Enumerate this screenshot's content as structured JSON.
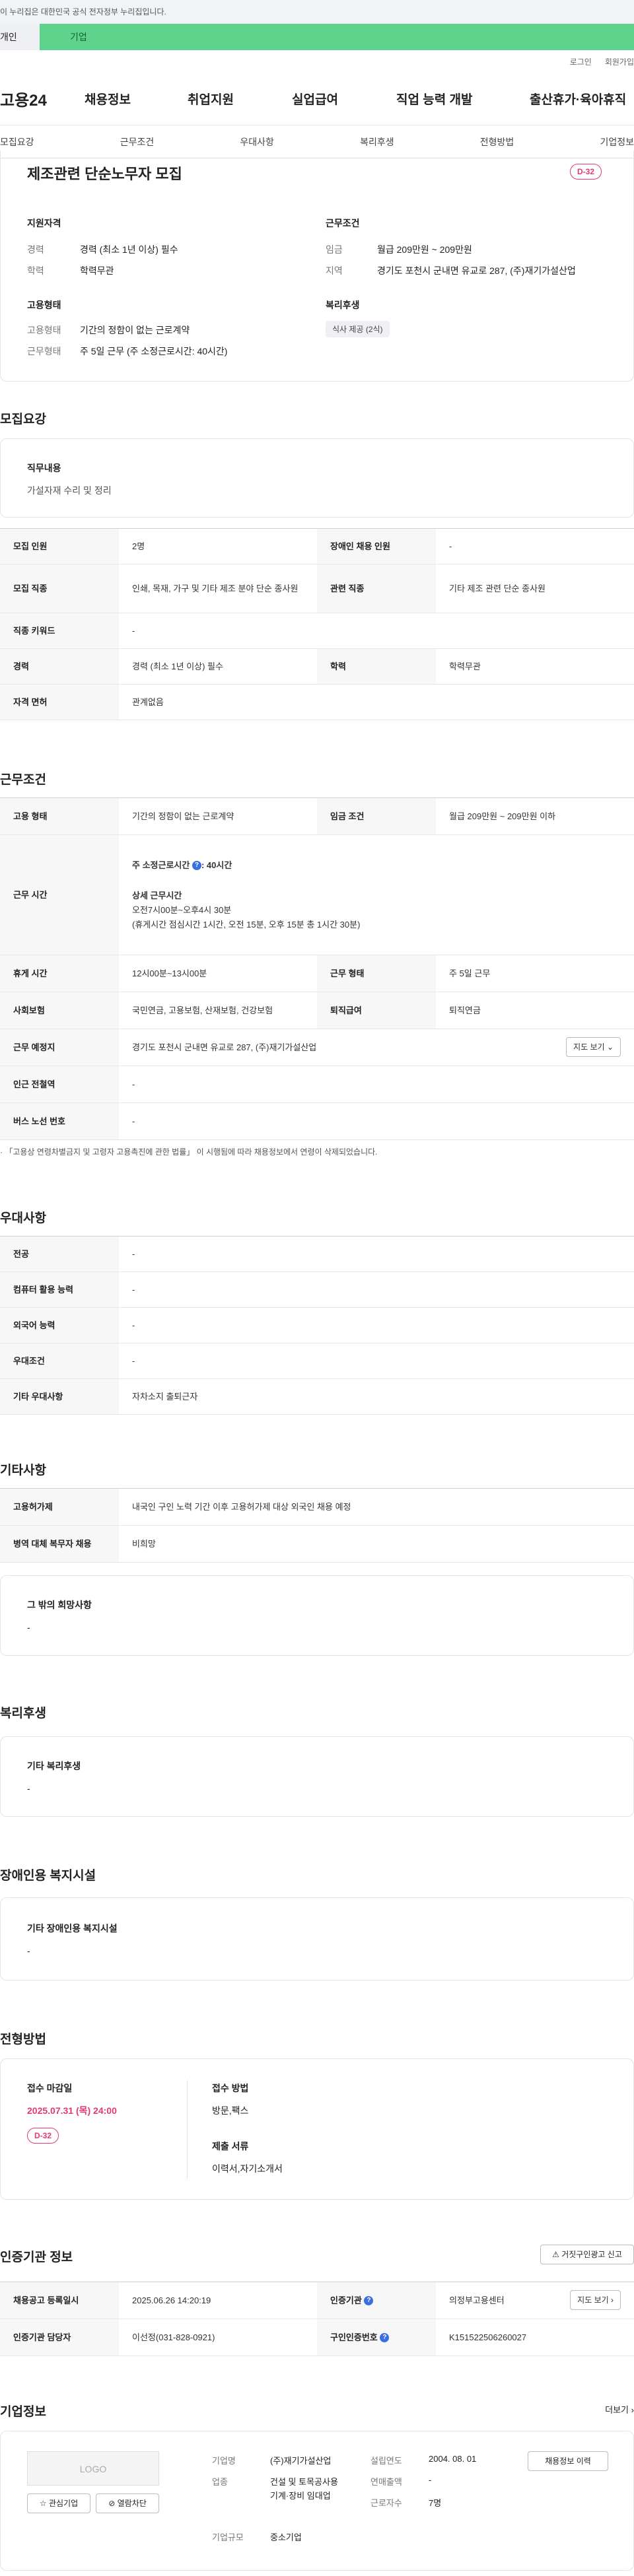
{
  "gov_banner": "이 누리집은 대한민국 공식 전자정부 누리집입니다.",
  "gnb": {
    "personal": "개인",
    "company": "기업"
  },
  "util": {
    "login": "로그인",
    "signup": "회원가입"
  },
  "logo": "고용24",
  "main_menu": [
    "채용정보",
    "취업지원",
    "실업급여",
    "직업 능력 개발",
    "출산휴가·육아휴직"
  ],
  "sub_menu": [
    "모집요강",
    "근무조건",
    "우대사항",
    "복리후생",
    "전형방법",
    "기업정보"
  ],
  "job": {
    "title": "제조관련 단순노무자 모집",
    "dday": "D-32",
    "qual_title": "지원자격",
    "career_lbl": "경력",
    "career": "경력 (최소 1년 이상) 필수",
    "edu_lbl": "학력",
    "edu": "학력무관",
    "cond_title": "근무조건",
    "wage_lbl": "임금",
    "wage": "월급 209만원 ~ 209만원",
    "area_lbl": "지역",
    "area": "경기도 포천시 군내면 유교로 287, (주)재기가설산업",
    "emp_title": "고용형태",
    "emptype_lbl": "고용형태",
    "emptype": "기간의 정함이 없는 근로계약",
    "worktype_lbl": "근무형태",
    "worktype": "주 5일 근무 (주 소정근로시간: 40시간)",
    "welfare_title": "복리후생",
    "welfare_tag": "식사 제공 (2식)"
  },
  "recruit": {
    "heading": "모집요강",
    "duty_title": "직무내용",
    "duty": "가설자재 수리 및 정리",
    "rows": {
      "count_h": "모집 인원",
      "count": "2명",
      "disabled_h": "장애인 채용 인원",
      "disabled": "-",
      "job_h": "모집 직종",
      "job": "인쇄, 목재, 가구 및 기타 제조 분야 단순 종사원",
      "rel_h": "관련 직종",
      "rel": "기타 제조 관련 단순 종사원",
      "kw_h": "직종 키워드",
      "kw": "-",
      "career_h": "경력",
      "career": "경력 (최소 1년 이상) 필수",
      "edu_h": "학력",
      "edu": "학력무관",
      "license_h": "자격 면허",
      "license": "관계없음"
    }
  },
  "conditions": {
    "heading": "근무조건",
    "emp_h": "고용 형태",
    "emp": "기간의 정함이 없는 근로계약",
    "wage_h": "임금 조건",
    "wage": "월급 209만원 ~ 209만원 이하",
    "hours_h": "근무 시간",
    "hours_week": "주 소정근로시간",
    "hours_week_val": ": 40시간",
    "hours_detail_title": "상세 근무시간",
    "hours_detail1": "오전7시00분~오후4시 30분",
    "hours_detail2": "(휴게시간 점심시간 1시간, 오전 15분, 오후 15분 총 1시간 30분)",
    "rest_h": "휴게 시간",
    "rest": "12시00분~13시00분",
    "form_h": "근무 형태",
    "form": "주 5일 근무",
    "ins_h": "사회보험",
    "ins": "국민연금, 고용보험, 산재보험, 건강보험",
    "ret_h": "퇴직급여",
    "ret": "퇴직연금",
    "place_h": "근무 예정지",
    "place": "경기도 포천시 군내면 유교로 287, (주)재기가설산업",
    "map_btn": "지도 보기",
    "subway_h": "인근 전철역",
    "subway": "-",
    "bus_h": "버스 노선 번호",
    "bus": "-",
    "note": "「고용상 연령차별금지 및 고령자 고용촉진에 관한 법률」 이 시행됨에 따라 채용정보에서 연령이 삭제되었습니다."
  },
  "pref": {
    "heading": "우대사항",
    "major_h": "전공",
    "major": "-",
    "pc_h": "컴퓨터 활용 능력",
    "pc": "-",
    "lang_h": "외국어 능력",
    "lang": "-",
    "cond_h": "우대조건",
    "cond": "-",
    "etc_h": "기타 우대사항",
    "etc": "자차소지 출퇴근자"
  },
  "etc": {
    "heading": "기타사항",
    "foreign_h": "고용허가제",
    "foreign": "내국인 구인 노력 기간 이후 고용허가제 대상 외국인 채용 예정",
    "mil_h": "병역 대체 복무자 채용",
    "mil": "비희망",
    "other_title": "그 밖의 희망사항",
    "other": "-"
  },
  "welfare": {
    "heading": "복리후생",
    "title": "기타 복리후생",
    "value": "-"
  },
  "disability": {
    "heading": "장애인용 복지시설",
    "title": "기타 장애인용 복지시설",
    "value": "-"
  },
  "process": {
    "heading": "전형방법",
    "deadline_lbl": "접수 마감일",
    "deadline": "2025.07.31 (목) 24:00",
    "dday": "D-32",
    "method_lbl": "접수 방법",
    "method": "방문,팩스",
    "docs_lbl": "제출 서류",
    "docs": "이력서,자기소개서"
  },
  "auth": {
    "heading": "인증기관 정보",
    "report_btn": "거짓구인광고 신고",
    "reg_h": "채용공고 등록일시",
    "reg": "2025.06.26 14:20:19",
    "org_h": "인증기관",
    "org": "의정부고용센터",
    "map_btn": "지도 보기",
    "mgr_h": "인증기관 담당자",
    "mgr": "이선정(031-828-0921)",
    "no_h": "구인인증번호",
    "no": "K151522506260027"
  },
  "company": {
    "heading": "기업정보",
    "more": "더보기",
    "logo": "LOGO",
    "fav": "관심기업",
    "block": "열람차단",
    "name_lbl": "기업명",
    "name": "(주)재기가설산업",
    "ind_lbl": "업종",
    "ind": "건설 및 토목공사용 기계·장비 임대업",
    "size_lbl": "기업규모",
    "size": "중소기업",
    "year_lbl": "설립연도",
    "year": "2004. 08. 01",
    "sales_lbl": "연매출액",
    "sales": "-",
    "emp_lbl": "근로자수",
    "emp": "7명",
    "jobs_btn": "채용정보 이력"
  }
}
